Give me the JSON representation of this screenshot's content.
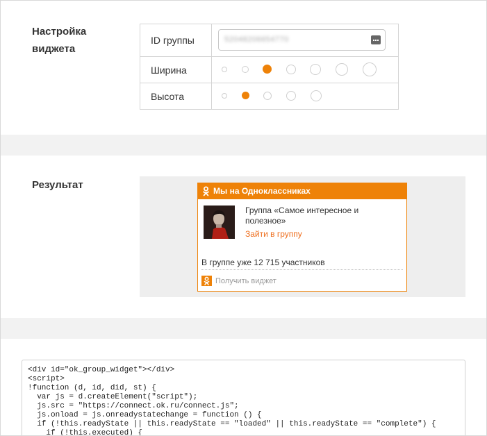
{
  "settings": {
    "title_line1": "Настройка",
    "title_line2": "виджета",
    "id_label": "ID группы",
    "id_value": "52048206654770",
    "width_label": "Ширина",
    "width_options": 7,
    "width_selected_index": 2,
    "height_label": "Высота",
    "height_options": 5,
    "height_selected_index": 1
  },
  "result": {
    "title": "Результат",
    "widget": {
      "header": "Мы на Одноклассниках",
      "group_name": "Группа «Самое интересное и полезное»",
      "join_link": "Зайти в группу",
      "members": "В группе уже 12 715 участников",
      "footer_link": "Получить виджет"
    }
  },
  "code": {
    "lines": "<div id=\"ok_group_widget\"></div>\n<script>\n!function (d, id, did, st) {\n  var js = d.createElement(\"script\");\n  js.src = \"https://connect.ok.ru/connect.js\";\n  js.onload = js.onreadystatechange = function () {\n  if (!this.readyState || this.readyState == \"loaded\" || this.readyState == \"complete\") {\n    if (!this.executed) {"
  },
  "colors": {
    "accent": "#ee8208",
    "link": "#ee6d1b",
    "band": "#f2f2f2"
  }
}
